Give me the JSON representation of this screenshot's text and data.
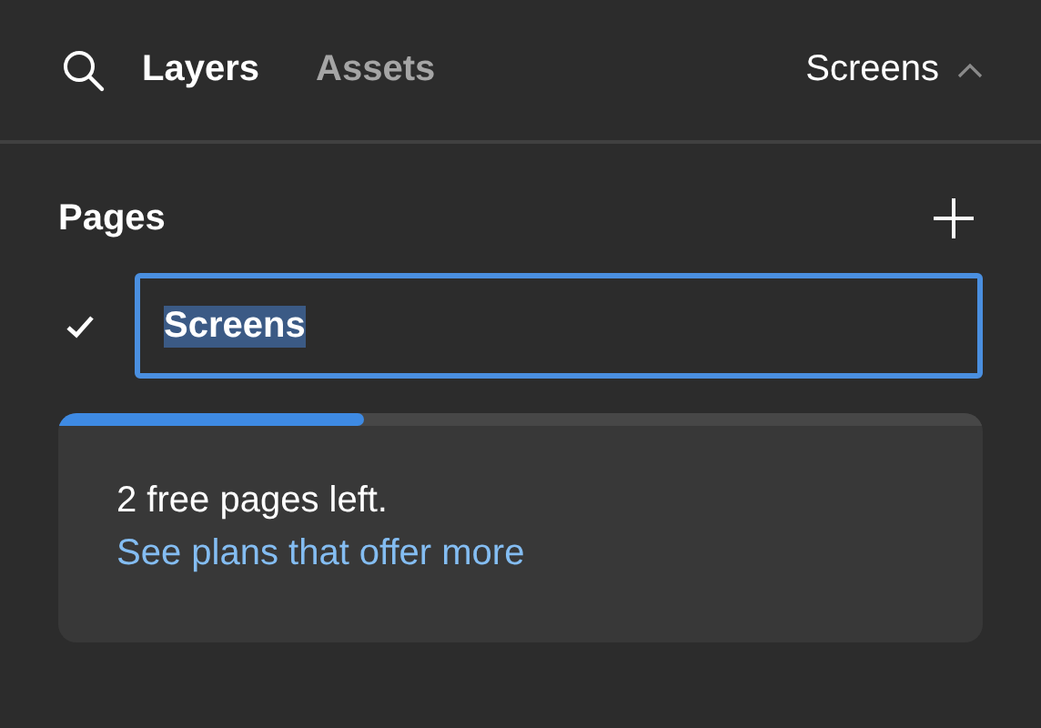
{
  "tabs": [
    {
      "label": "Layers",
      "selected": true
    },
    {
      "label": "Assets",
      "selected": false
    }
  ],
  "page_selector": {
    "label": "Screens"
  },
  "pages": {
    "title": "Pages",
    "items": [
      {
        "name": "Screens",
        "checked": true
      }
    ]
  },
  "quota": {
    "level": 0.33,
    "message": "2 free pages left.",
    "link": "See plans that offer more"
  }
}
